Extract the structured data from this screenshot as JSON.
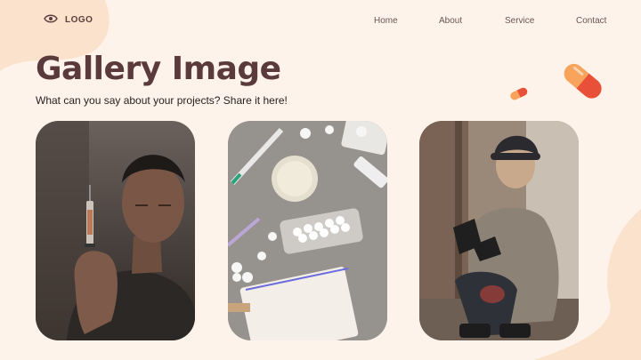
{
  "header": {
    "logo_label": "LOGO",
    "nav": [
      {
        "label": "Home"
      },
      {
        "label": "About"
      },
      {
        "label": "Service"
      },
      {
        "label": "Contact"
      }
    ]
  },
  "hero": {
    "title": "Gallery Image",
    "subtitle": "What can you say about your projects? Share it here!"
  },
  "colors": {
    "background": "#fdf3ea",
    "blob": "#fbe2cc",
    "title": "#5a3a3a",
    "pill_orange": "#f7a35c",
    "pill_red": "#e8503a"
  },
  "icons": {
    "logo": "eye-icon",
    "decor_large": "capsule-pill-icon",
    "decor_small": "capsule-pill-icon"
  }
}
